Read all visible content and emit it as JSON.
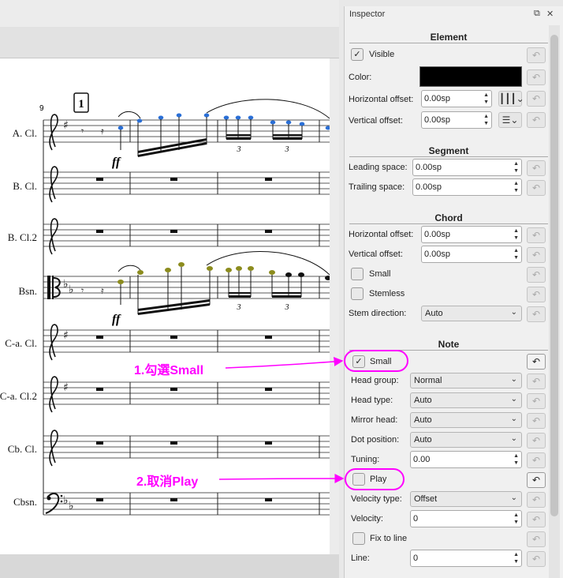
{
  "score": {
    "measure_number": "9",
    "rehearsal_mark": "1",
    "dynamic": "ff",
    "tuplet_label": "3",
    "instruments": [
      "A. Cl.",
      "B. Cl.",
      "B. Cl.2",
      "Bsn.",
      "C-a. Cl.",
      "C-a. Cl.2",
      "Cb. Cl.",
      "Cbsn."
    ],
    "accent_colors": {
      "selected_blue": "#2a6fd6",
      "selected_olive": "#8c8c1e"
    }
  },
  "inspector": {
    "title": "Inspector",
    "element": {
      "heading": "Element",
      "visible_label": "Visible",
      "visible_checked": true,
      "color_label": "Color:",
      "color_value": "#000000",
      "h_offset_label": "Horizontal offset:",
      "h_offset_value": "0.00sp",
      "v_offset_label": "Vertical offset:",
      "v_offset_value": "0.00sp"
    },
    "segment": {
      "heading": "Segment",
      "leading_label": "Leading space:",
      "leading_value": "0.00sp",
      "trailing_label": "Trailing space:",
      "trailing_value": "0.00sp"
    },
    "chord": {
      "heading": "Chord",
      "h_offset_label": "Horizontal offset:",
      "h_offset_value": "0.00sp",
      "v_offset_label": "Vertical offset:",
      "v_offset_value": "0.00sp",
      "small_label": "Small",
      "stemless_label": "Stemless",
      "stem_dir_label": "Stem direction:",
      "stem_dir_value": "Auto"
    },
    "note": {
      "heading": "Note",
      "small_label": "Small",
      "small_checked": true,
      "head_group_label": "Head group:",
      "head_group_value": "Normal",
      "head_type_label": "Head type:",
      "head_type_value": "Auto",
      "mirror_label": "Mirror head:",
      "mirror_value": "Auto",
      "dot_label": "Dot position:",
      "dot_value": "Auto",
      "tuning_label": "Tuning:",
      "tuning_value": "0.00",
      "play_label": "Play",
      "play_checked": false,
      "velocity_type_label": "Velocity type:",
      "velocity_type_value": "Offset",
      "velocity_label": "Velocity:",
      "velocity_value": "0",
      "fix_line_label": "Fix to line",
      "line_label": "Line:",
      "line_value": "0"
    }
  },
  "annotations": {
    "step1": "1.勾選Small",
    "step2": "2.取消Play",
    "color": "#ff00ff"
  }
}
